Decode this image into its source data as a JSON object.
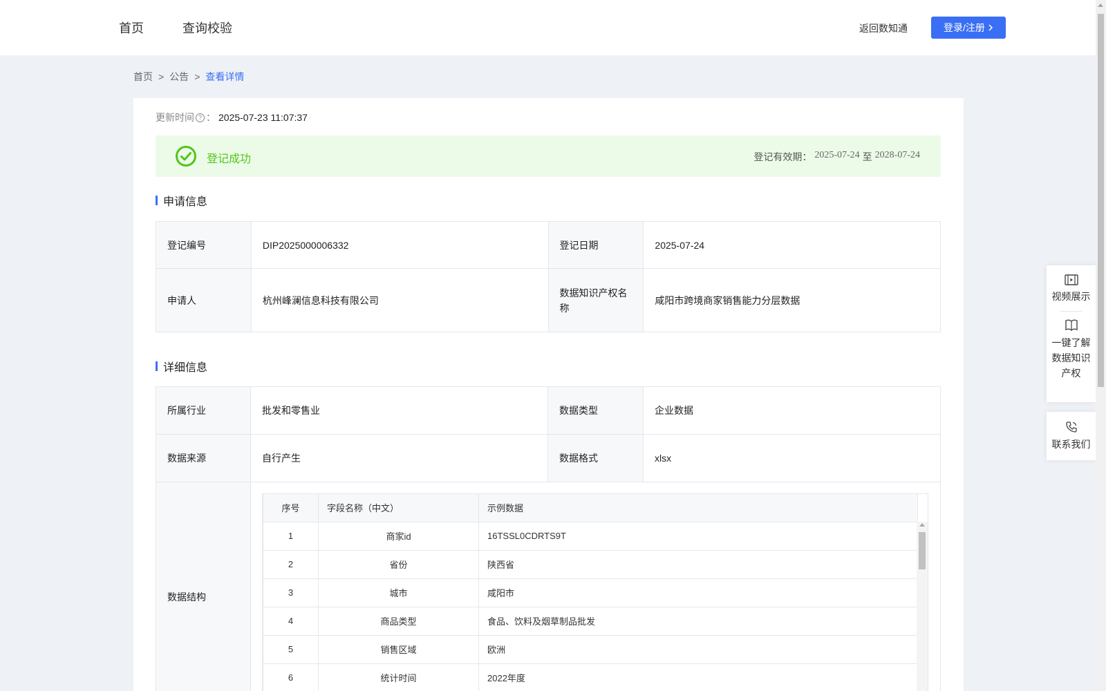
{
  "nav": {
    "home": "首页",
    "query": "查询校验",
    "back": "返回数知通",
    "login": "登录/注册"
  },
  "breadcrumb": {
    "home": "首页",
    "notice": "公告",
    "current": "查看详情",
    "sep": ">"
  },
  "update": {
    "label": "更新时间",
    "colon": "：",
    "value": "2025-07-23 11:07:37"
  },
  "status": {
    "text": "登记成功",
    "validity_label": "登记有效期：",
    "start": "2025-07-24",
    "to": "至",
    "end": "2028-07-24",
    "color": "#52c41a"
  },
  "apply_info": {
    "title": "申请信息",
    "rows": [
      {
        "l1": "登记编号",
        "v1": "DIP2025000006332",
        "l2": "登记日期",
        "v2": "2025-07-24"
      },
      {
        "l1": "申请人",
        "v1": "杭州峰澜信息科技有限公司",
        "l2": "数据知识产权名称",
        "v2": "咸阳市跨境商家销售能力分层数据"
      }
    ]
  },
  "detail_info": {
    "title": "详细信息",
    "rows": [
      {
        "l1": "所属行业",
        "v1": "批发和零售业",
        "l2": "数据类型",
        "v2": "企业数据"
      },
      {
        "l1": "数据来源",
        "v1": "自行产生",
        "l2": "数据格式",
        "v2": "xlsx"
      }
    ],
    "structure_label": "数据结构",
    "structure": {
      "headers": [
        "序号",
        "字段名称（中文）",
        "示例数据"
      ],
      "rows": [
        [
          "1",
          "商家id",
          "16TSSL0CDRTS9T"
        ],
        [
          "2",
          "省份",
          "陕西省"
        ],
        [
          "3",
          "城市",
          "咸阳市"
        ],
        [
          "4",
          "商品类型",
          "食品、饮料及烟草制品批发"
        ],
        [
          "5",
          "销售区域",
          "欧洲"
        ],
        [
          "6",
          "统计时间",
          "2022年度"
        ]
      ]
    }
  },
  "float": {
    "video": "视频展示",
    "learn": "一键了解数据知识产权",
    "contact": "联系我们"
  },
  "colors": {
    "accent": "#3a6ff5",
    "success_bg": "#ecfbe8"
  }
}
